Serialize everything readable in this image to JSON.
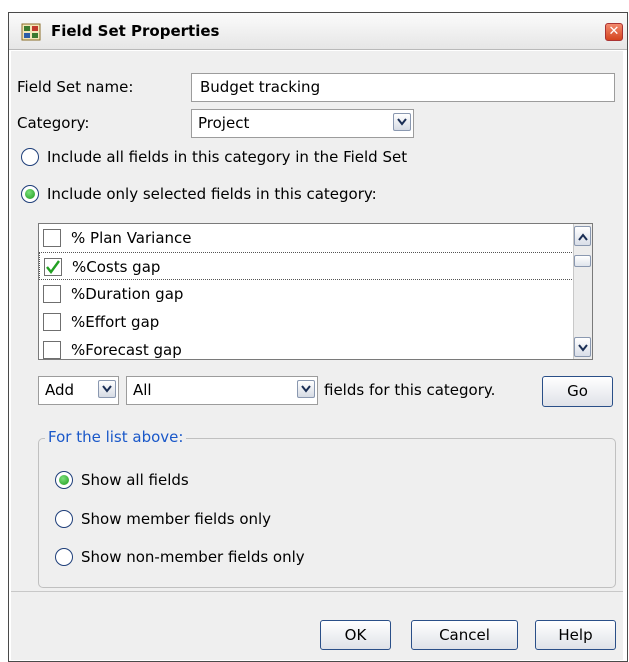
{
  "window": {
    "title": "Field Set Properties",
    "close_glyph": "✕",
    "icon": "field-set-app-icon"
  },
  "form": {
    "name_label": "Field Set name:",
    "name_value": "Budget tracking",
    "category_label": "Category:",
    "category_value": "Project",
    "radio_all_label": "Include all fields in this category in the Field Set",
    "radio_selected_label": "Include only selected fields in this category:",
    "radio_selected_checked": true
  },
  "field_list": {
    "items": [
      {
        "label": "% Plan Variance",
        "checked": false
      },
      {
        "label": "%Costs gap",
        "checked": true
      },
      {
        "label": "%Duration gap",
        "checked": false
      },
      {
        "label": "%Effort gap",
        "checked": false
      },
      {
        "label": "%Forecast gap",
        "checked": false
      }
    ]
  },
  "action_row": {
    "action_value": "Add",
    "scope_value": "All",
    "suffix_text": "fields for this category.",
    "go_label": "Go"
  },
  "list_filter": {
    "title": "For the list above:",
    "options": [
      {
        "label": "Show all fields",
        "checked": true
      },
      {
        "label": "Show member fields only",
        "checked": false
      },
      {
        "label": "Show non-member fields only",
        "checked": false
      }
    ]
  },
  "buttons": {
    "ok": "OK",
    "cancel": "Cancel",
    "help": "Help"
  },
  "colors": {
    "group_title": "#1a58c9",
    "radio_fill": "#1c9a1c",
    "checkmark": "#22a022"
  }
}
